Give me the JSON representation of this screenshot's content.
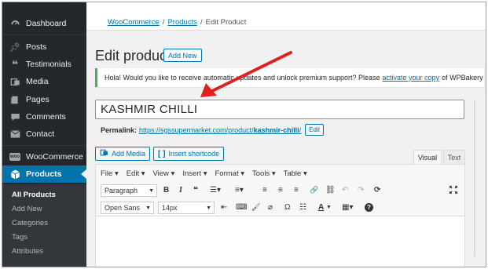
{
  "sidebar": {
    "items": [
      {
        "label": "Dashboard",
        "icon": "dashboard-icon"
      },
      {
        "label": "Posts",
        "icon": "pin-icon"
      },
      {
        "label": "Testimonials",
        "icon": "quote-icon"
      },
      {
        "label": "Media",
        "icon": "media-icon"
      },
      {
        "label": "Pages",
        "icon": "pages-icon"
      },
      {
        "label": "Comments",
        "icon": "comments-icon"
      },
      {
        "label": "Contact",
        "icon": "mail-icon"
      },
      {
        "label": "WooCommerce",
        "icon": "woocommerce-icon"
      },
      {
        "label": "Products",
        "icon": "products-icon"
      }
    ],
    "woo_badge": "woo",
    "submenu": [
      "All Products",
      "Add New",
      "Categories",
      "Tags",
      "Attributes"
    ]
  },
  "breadcrumb": {
    "items": [
      "WooCommerce",
      "Products",
      "Edit Product"
    ],
    "separator": "/"
  },
  "page": {
    "title": "Edit product",
    "add_new_label": "Add New"
  },
  "notice": {
    "text_before": "Hola! Would you like to receive automatic updates and unlock premium support? Please",
    "link_text": "activate your copy",
    "text_after": "of WPBakery Page B"
  },
  "product": {
    "title": "KASHMIR CHILLI",
    "permalink_label": "Permalink:",
    "permalink_base": "https://sgssupermarket.com/product/",
    "permalink_slug": "kashmir-chilli",
    "permalink_end": "/",
    "edit_label": "Edit"
  },
  "editor": {
    "add_media_label": "Add Media",
    "insert_shortcode_label": "Insert shortcode",
    "tab_visual": "Visual",
    "tab_text": "Text",
    "menus": [
      "File ▾",
      "Edit ▾",
      "View ▾",
      "Insert ▾",
      "Format ▾",
      "Tools ▾",
      "Table ▾"
    ],
    "format_select": "Paragraph",
    "font_select": "Open Sans",
    "size_select": "14px",
    "toolbar1_buttons": [
      "B",
      "I",
      "❝",
      "☰▾",
      "≡▾",
      "≡",
      "≡",
      "≡",
      "🔗",
      "⛓",
      "↶",
      "↷",
      "⟳"
    ],
    "toolbar2_buttons": [
      "⇤",
      "⌨",
      "🖌",
      "⌀",
      "Ω",
      "☷",
      "A",
      "▦▾",
      "?"
    ]
  },
  "colors": {
    "sidebar_bg": "#23282d",
    "accent": "#0073aa",
    "notice_border": "#46b450",
    "arrow": "#e0201f"
  }
}
